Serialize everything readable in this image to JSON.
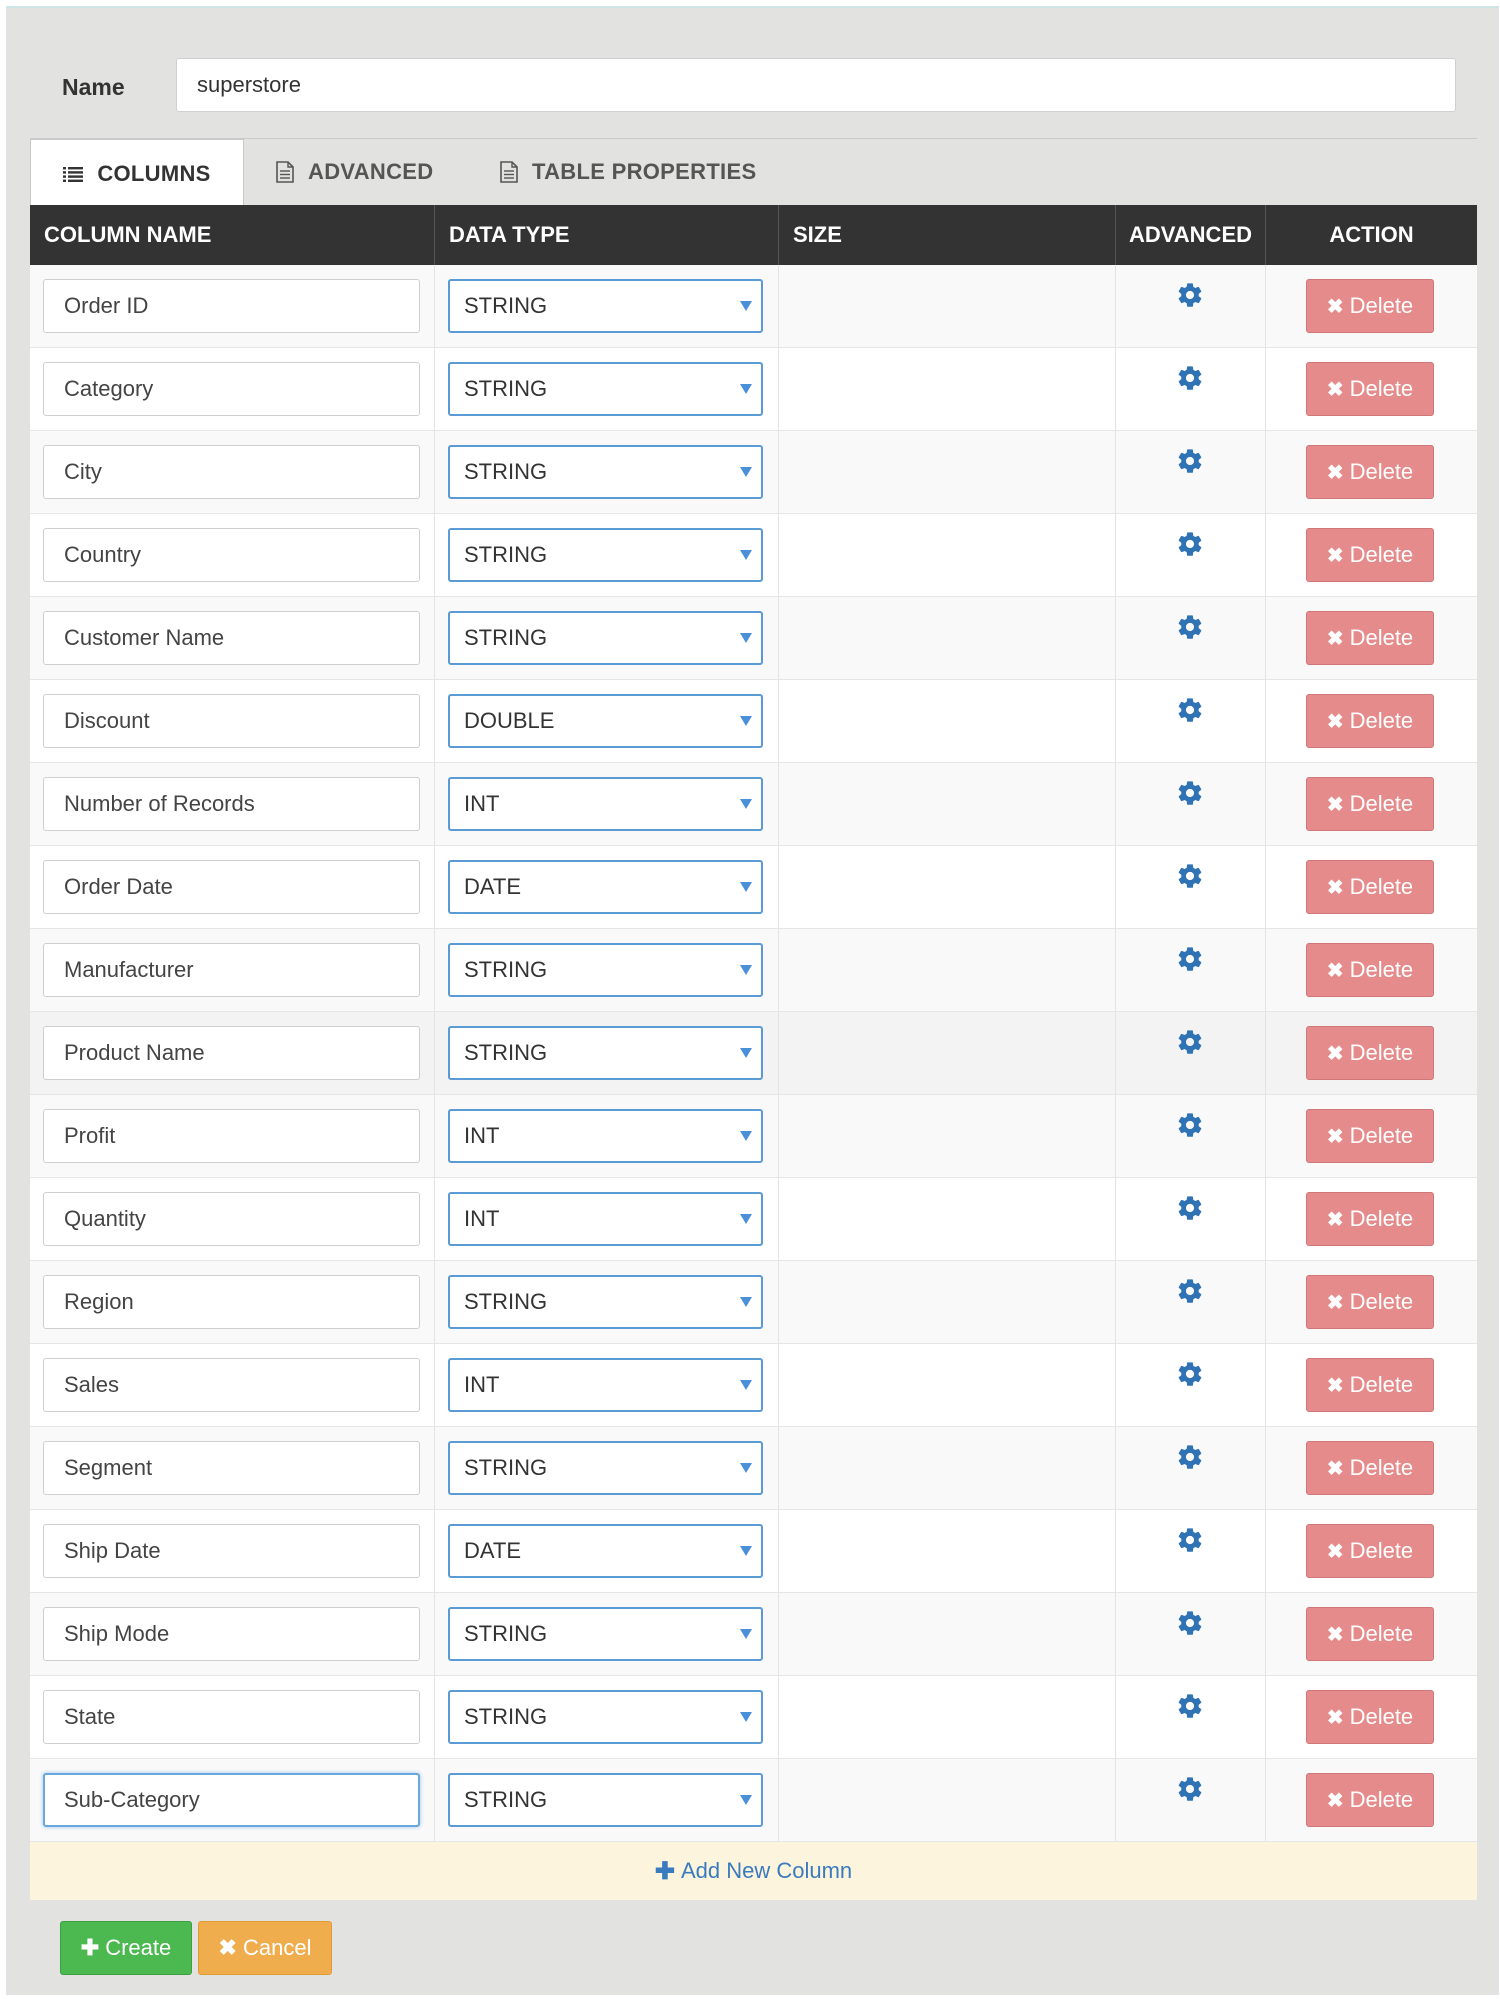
{
  "form": {
    "name_label": "Name",
    "name_value": "superstore"
  },
  "tabs": [
    {
      "label": "COLUMNS",
      "icon": "list-icon",
      "active": true
    },
    {
      "label": "ADVANCED",
      "icon": "document-icon",
      "active": false
    },
    {
      "label": "TABLE PROPERTIES",
      "icon": "document-icon",
      "active": false
    }
  ],
  "table": {
    "headers": [
      "COLUMN NAME",
      "DATA TYPE",
      "SIZE",
      "ADVANCED",
      "ACTION"
    ],
    "delete_label": "Delete",
    "rows": [
      {
        "name": "Order ID",
        "type": "STRING"
      },
      {
        "name": "Category",
        "type": "STRING"
      },
      {
        "name": "City",
        "type": "STRING"
      },
      {
        "name": "Country",
        "type": "STRING"
      },
      {
        "name": "Customer Name",
        "type": "STRING"
      },
      {
        "name": "Discount",
        "type": "DOUBLE"
      },
      {
        "name": "Number of Records",
        "type": "INT"
      },
      {
        "name": "Order Date",
        "type": "DATE"
      },
      {
        "name": "Manufacturer",
        "type": "STRING"
      },
      {
        "name": "Product Name",
        "type": "STRING"
      },
      {
        "name": "Profit",
        "type": "INT"
      },
      {
        "name": "Quantity",
        "type": "INT"
      },
      {
        "name": "Region",
        "type": "STRING"
      },
      {
        "name": "Sales",
        "type": "INT"
      },
      {
        "name": "Segment",
        "type": "STRING"
      },
      {
        "name": "Ship Date",
        "type": "DATE"
      },
      {
        "name": "Ship Mode",
        "type": "STRING"
      },
      {
        "name": "State",
        "type": "STRING"
      },
      {
        "name": "Sub-Category",
        "type": "STRING"
      }
    ],
    "add_label": "Add New Column"
  },
  "actions": {
    "create_label": "Create",
    "cancel_label": "Cancel"
  },
  "colors": {
    "header_bg": "#333333",
    "delete_btn": "#e58b8b",
    "create_btn": "#4cb850",
    "cancel_btn": "#f0ad4e",
    "accent_blue": "#337ab7",
    "add_row_bg": "#fcf4dc"
  }
}
